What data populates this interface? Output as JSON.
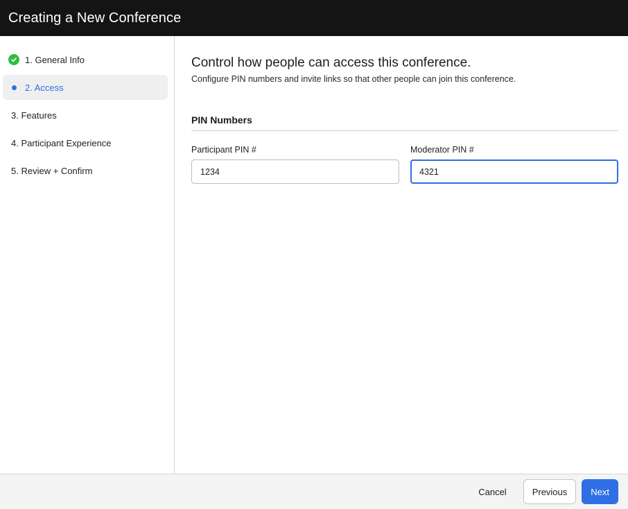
{
  "header": {
    "title": "Creating a New Conference"
  },
  "sidebar": {
    "steps": [
      {
        "label": "1. General Info",
        "status": "complete",
        "icon": "check-circle-icon"
      },
      {
        "label": "2. Access",
        "status": "active",
        "icon": "dot-icon"
      },
      {
        "label": "3. Features",
        "status": "pending"
      },
      {
        "label": "4. Participant Experience",
        "status": "pending"
      },
      {
        "label": "5. Review + Confirm",
        "status": "pending"
      }
    ]
  },
  "main": {
    "heading": "Control how people can access this conference.",
    "subtitle": "Configure PIN numbers and invite links so that other people can join this conference.",
    "section": {
      "title": "PIN Numbers",
      "participant_pin": {
        "label": "Participant PIN #",
        "value": "1234"
      },
      "moderator_pin": {
        "label": "Moderator PIN #",
        "value": "4321",
        "focused": true
      }
    }
  },
  "footer": {
    "cancel_label": "Cancel",
    "previous_label": "Previous",
    "next_label": "Next"
  },
  "colors": {
    "accent": "#2f6fe4",
    "success": "#2fbd47",
    "header_bg": "#141414"
  }
}
